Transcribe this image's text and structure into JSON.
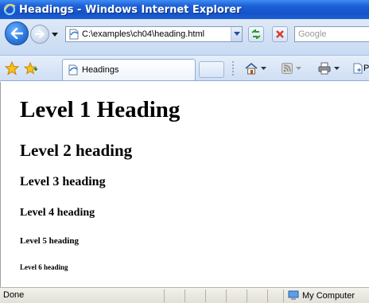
{
  "window": {
    "title": "Headings - Windows Internet Explorer"
  },
  "address_bar": {
    "url": "C:\\examples\\ch04\\heading.html"
  },
  "search": {
    "placeholder": "Google"
  },
  "tab": {
    "label": "Headings"
  },
  "command_bar": {
    "page_label_partial": "P"
  },
  "page": {
    "headings": [
      "Level 1 Heading",
      "Level 2 heading",
      "Level 3 heading",
      "Level 4 heading",
      "Level 5 heading",
      "Level 6 heading"
    ]
  },
  "status_bar": {
    "status": "Done",
    "zone": "My Computer"
  },
  "colors": {
    "titlebar": "#1d61d8",
    "toolbar": "#cfdef4"
  },
  "icons": [
    "ie-logo-icon",
    "back-arrow-icon",
    "forward-arrow-icon",
    "page-icon",
    "refresh-icon",
    "stop-icon",
    "favorites-star-icon",
    "add-favorites-icon",
    "home-icon",
    "feeds-icon",
    "print-icon",
    "page-menu-icon",
    "my-computer-icon"
  ]
}
